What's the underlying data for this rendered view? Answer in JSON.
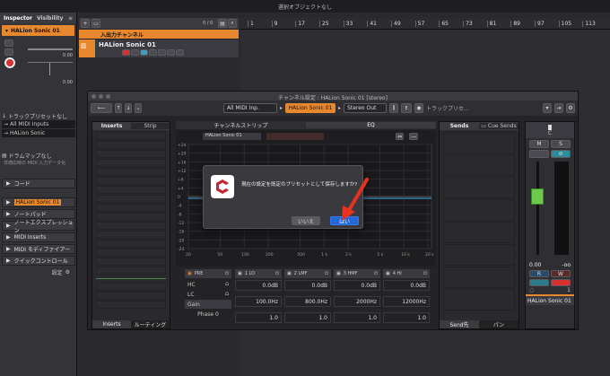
{
  "app": {
    "window_title": "選択オブジェクトなし",
    "dialog_title": "チャンネル設定 : HALion Sonic 01 [stereo]"
  },
  "inspector": {
    "tab_inspector": "Inspector",
    "tab_visibility": "Visibility",
    "track_name": "HALion Sonic 01",
    "level_value_1": "0.00",
    "level_value_2": "0.00",
    "track_preset": "トラックプリセットなし",
    "input": "All MIDI Inputs",
    "output": "HALion Sonic",
    "drum_map": "ドラムマップなし",
    "midi_input_note": "非適応時の MIDI 入力データ化",
    "sections": [
      "コード",
      "HALion Sonic 01",
      "ノートパッド",
      "ノートエクスプレッション",
      "MIDI Inserts",
      "MIDI モディファイアー",
      "クイックコントロール"
    ],
    "settings_label": "設定"
  },
  "tracklist": {
    "count": "0 / 0",
    "folder_name": "入出力チャンネル",
    "track_name": "HALion Sonic 01"
  },
  "ruler": {
    "marks": [
      "1",
      "9",
      "17",
      "25",
      "33",
      "41",
      "49",
      "57",
      "65",
      "73",
      "81",
      "89",
      "97",
      "105",
      "113"
    ]
  },
  "channel": {
    "input_route": "All MIDI Inp.",
    "channel_name": "HALion Sonic 01",
    "output_route": "Stereo Out",
    "track_preset_btn": "トラックプリセ...",
    "tab_inserts": "Inserts",
    "tab_strip": "Strip",
    "tab_channelstrip": "チャンネルストリップ",
    "tab_eq": "EQ",
    "tab_sends": "Sends",
    "tab_cuesends": "Cue Sends",
    "bottom_inserts": "Inserts",
    "bottom_routing": "ルーティング",
    "bottom_sendto": "Send先",
    "bottom_pan": "パン",
    "eq_channel_label": "HALion Sonic 01",
    "db_axis": [
      "+24",
      "+20",
      "+16",
      "+12",
      "+8",
      "+4",
      "0",
      "-4",
      "-8",
      "-12",
      "-16",
      "-20",
      "-24"
    ],
    "freq_axis": [
      "20",
      "50",
      "100",
      "200",
      "500",
      "1 k",
      "2 k",
      "5 k",
      "10 k",
      "20 k"
    ],
    "pre": {
      "label": "PRE",
      "hc": "HC",
      "lc": "LC",
      "gain": "Gain",
      "phase": "Phase 0"
    },
    "bands": [
      {
        "name": "1 LO",
        "gain": "0.0dB",
        "freq": "100.0Hz",
        "q": "1.0"
      },
      {
        "name": "2 LMF",
        "gain": "0.0dB",
        "freq": "800.0Hz",
        "q": "1.0"
      },
      {
        "name": "3 HMF",
        "gain": "0.0dB",
        "freq": "2000Hz",
        "q": "1.0"
      },
      {
        "name": "4 HI",
        "gain": "0.0dB",
        "freq": "12000Hz",
        "q": "1.0"
      }
    ],
    "fader": {
      "pan_label": "C",
      "m": "M",
      "s": "S",
      "value": "0.00",
      "peak": "-oo",
      "r": "R",
      "w": "W",
      "channel_number": "1",
      "name": "HALion Sonic 01"
    }
  },
  "modal": {
    "message": "現在の設定を既定のプリセットとして保存しますか?",
    "no_button": "いいえ",
    "yes_button": "はい"
  },
  "colors": {
    "accent_orange": "#e8882e",
    "selection_blue": "#2467d6",
    "arrow_red": "#e5331f",
    "eq_line": "#3a8fc8"
  }
}
